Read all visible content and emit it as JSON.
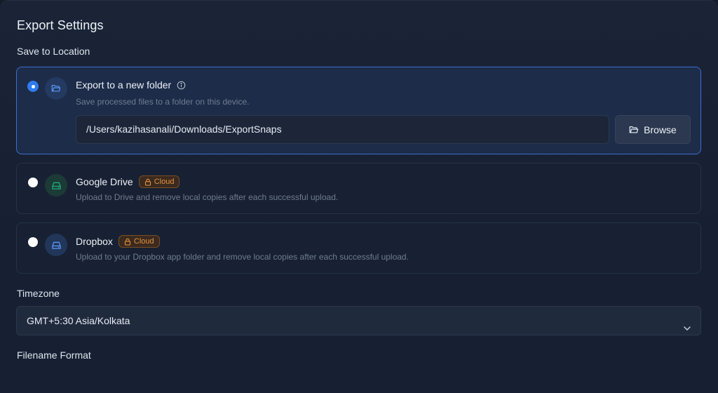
{
  "page": {
    "title": "Export Settings",
    "save_location_label": "Save to Location",
    "timezone_label": "Timezone",
    "filename_format_label": "Filename Format"
  },
  "options": [
    {
      "title": "Export to a new folder",
      "description": "Save processed files to a folder on this device.",
      "selected": true,
      "icon": "folder-icon",
      "path_value": "/Users/kazihasanali/Downloads/ExportSnaps",
      "browse_label": "Browse"
    },
    {
      "title": "Google Drive",
      "badge": "Cloud",
      "description": "Upload to Drive and remove local copies after each successful upload.",
      "selected": false,
      "icon": "drive-icon"
    },
    {
      "title": "Dropbox",
      "badge": "Cloud",
      "description": "Upload to your Dropbox app folder and remove local copies after each successful upload.",
      "selected": false,
      "icon": "drive-icon"
    }
  ],
  "timezone": {
    "selected": "GMT+5:30 Asia/Kolkata"
  },
  "colors": {
    "accent": "#2f7bf0",
    "badge": "#e3913e",
    "drive_icon": "#1fae7a"
  }
}
